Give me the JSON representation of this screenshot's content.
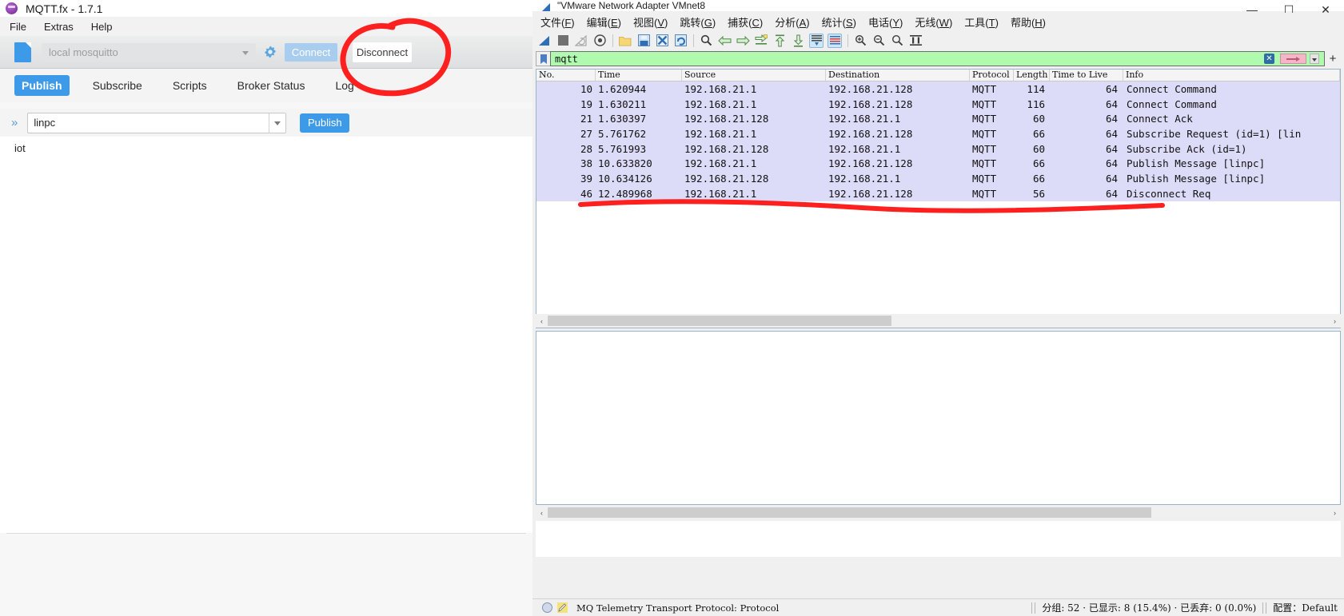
{
  "mqttfx": {
    "title": "MQTT.fx - 1.7.1",
    "logo_icon": "mqttfx-logo-icon",
    "menu": [
      "File",
      "Extras",
      "Help"
    ],
    "toolbar": {
      "file_icon": "file-icon",
      "broker_profile": "local mosquitto",
      "gear_icon": "gear-icon",
      "connect_label": "Connect",
      "disconnect_label": "Disconnect"
    },
    "tabs": [
      {
        "label": "Publish",
        "active": true
      },
      {
        "label": "Subscribe",
        "active": false
      },
      {
        "label": "Scripts",
        "active": false
      },
      {
        "label": "Broker Status",
        "active": false
      },
      {
        "label": "Log",
        "active": false
      }
    ],
    "publish": {
      "chevron_icon": "double-chevron-right-icon",
      "topic_value": "linpc",
      "publish_button": "Publish"
    },
    "payload": "iot"
  },
  "wireshark": {
    "title": "\"VMware Network Adapter VMnet8",
    "title_icon": "wireshark-shark-fin-icon",
    "window_controls": {
      "minimize": "—",
      "maximize": "☐",
      "close": "✕"
    },
    "menu": [
      {
        "label": "文件",
        "accel": "F"
      },
      {
        "label": "编辑",
        "accel": "E"
      },
      {
        "label": "视图",
        "accel": "V"
      },
      {
        "label": "跳转",
        "accel": "G"
      },
      {
        "label": "捕获",
        "accel": "C"
      },
      {
        "label": "分析",
        "accel": "A"
      },
      {
        "label": "统计",
        "accel": "S"
      },
      {
        "label": "电话",
        "accel": "Y"
      },
      {
        "label": "无线",
        "accel": "W"
      },
      {
        "label": "工具",
        "accel": "T"
      },
      {
        "label": "帮助",
        "accel": "H"
      }
    ],
    "toolbar_icons": [
      "start-capture-icon",
      "stop-capture-icon",
      "restart-capture-icon",
      "capture-options-icon",
      "open-file-icon",
      "save-file-icon",
      "close-file-icon",
      "reload-file-icon",
      "find-packet-icon",
      "go-back-icon",
      "go-forward-icon",
      "go-to-packet-icon",
      "go-first-packet-icon",
      "go-last-packet-icon",
      "auto-scroll-icon",
      "colorize-icon",
      "zoom-in-icon",
      "zoom-out-icon",
      "zoom-reset-icon",
      "resize-columns-icon"
    ],
    "filter": {
      "bookmark_icon": "bookmark-icon",
      "value": "mqtt",
      "clear_icon": "clear-filter-icon",
      "apply_icon": "apply-filter-arrow-icon",
      "dropdown_icon": "filter-dropdown-icon",
      "add_icon": "add-filter-button-icon"
    },
    "packet_list": {
      "columns": [
        "No.",
        "Time",
        "Source",
        "Destination",
        "Protocol",
        "Length",
        "Time to Live",
        "Info"
      ],
      "rows": [
        {
          "no": "10",
          "time": "1.620944",
          "src": "192.168.21.1",
          "dst": "192.168.21.128",
          "proto": "MQTT",
          "len": "114",
          "ttl": "64",
          "info": "Connect Command"
        },
        {
          "no": "19",
          "time": "1.630211",
          "src": "192.168.21.1",
          "dst": "192.168.21.128",
          "proto": "MQTT",
          "len": "116",
          "ttl": "64",
          "info": "Connect Command"
        },
        {
          "no": "21",
          "time": "1.630397",
          "src": "192.168.21.128",
          "dst": "192.168.21.1",
          "proto": "MQTT",
          "len": "60",
          "ttl": "64",
          "info": "Connect Ack"
        },
        {
          "no": "27",
          "time": "5.761762",
          "src": "192.168.21.1",
          "dst": "192.168.21.128",
          "proto": "MQTT",
          "len": "66",
          "ttl": "64",
          "info": "Subscribe Request (id=1) [lin"
        },
        {
          "no": "28",
          "time": "5.761993",
          "src": "192.168.21.128",
          "dst": "192.168.21.1",
          "proto": "MQTT",
          "len": "60",
          "ttl": "64",
          "info": "Subscribe Ack (id=1)"
        },
        {
          "no": "38",
          "time": "10.633820",
          "src": "192.168.21.1",
          "dst": "192.168.21.128",
          "proto": "MQTT",
          "len": "66",
          "ttl": "64",
          "info": "Publish Message [linpc]"
        },
        {
          "no": "39",
          "time": "10.634126",
          "src": "192.168.21.128",
          "dst": "192.168.21.1",
          "proto": "MQTT",
          "len": "66",
          "ttl": "64",
          "info": "Publish Message [linpc]"
        },
        {
          "no": "46",
          "time": "12.489968",
          "src": "192.168.21.1",
          "dst": "192.168.21.128",
          "proto": "MQTT",
          "len": "56",
          "ttl": "64",
          "info": "Disconnect Req"
        }
      ]
    },
    "status_bar": {
      "expert_icon": "expert-info-circle-icon",
      "comment_icon": "capture-comment-icon",
      "left_text": "MQ Telemetry Transport Protocol: Protocol",
      "counts_text": "分组: 52 · 已显示: 8 (15.4%) · 已丢弃: 0 (0.0%)",
      "profile_text": "配置：Default"
    },
    "scrollbars": {
      "left_arrow": "‹",
      "right_arrow": "›"
    }
  },
  "annotations": {
    "disconnect_circle": "red-hand-drawn-circle",
    "disconnect_underline": "red-hand-drawn-underline",
    "accent_red": "#fe1f1f"
  }
}
